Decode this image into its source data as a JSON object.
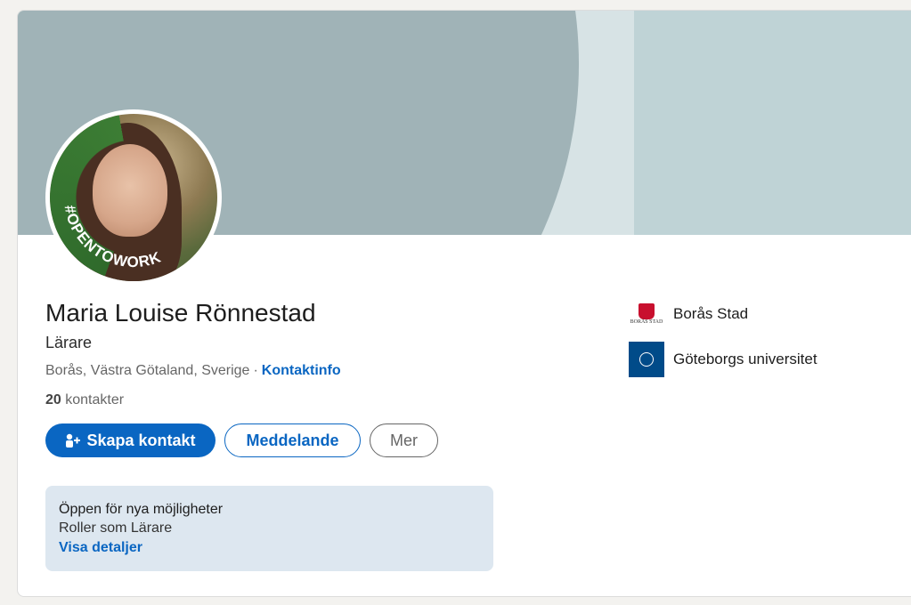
{
  "profile": {
    "name": "Maria Louise Rönnestad",
    "headline": "Lärare",
    "location": "Borås, Västra Götaland, Sverige",
    "location_separator": "·",
    "contact_info_link": "Kontaktinfo",
    "connections_count": "20",
    "connections_label": "kontakter",
    "open_to_work_badge": "#OPENTOWORK"
  },
  "actions": {
    "create_contact_label": "Skapa kontakt",
    "message_label": "Meddelande",
    "more_label": "Mer"
  },
  "open_to_work": {
    "title": "Öppen för nya möjligheter",
    "roles": "Roller som Lärare",
    "details_link": "Visa detaljer"
  },
  "organizations": [
    {
      "name": "Borås Stad",
      "logo_text": "BORÅS STAD",
      "icon": "boras-stad-logo"
    },
    {
      "name": "Göteborgs universitet",
      "logo_text": "GÖTEBORGS UNIVERSITET",
      "icon": "goteborgs-universitet-logo"
    }
  ],
  "colors": {
    "accent": "#0a66c2",
    "open_to_work_green": "#3c7d34",
    "cover_dark": "#a0b3b7",
    "cover_light": "#bfd3d6"
  }
}
